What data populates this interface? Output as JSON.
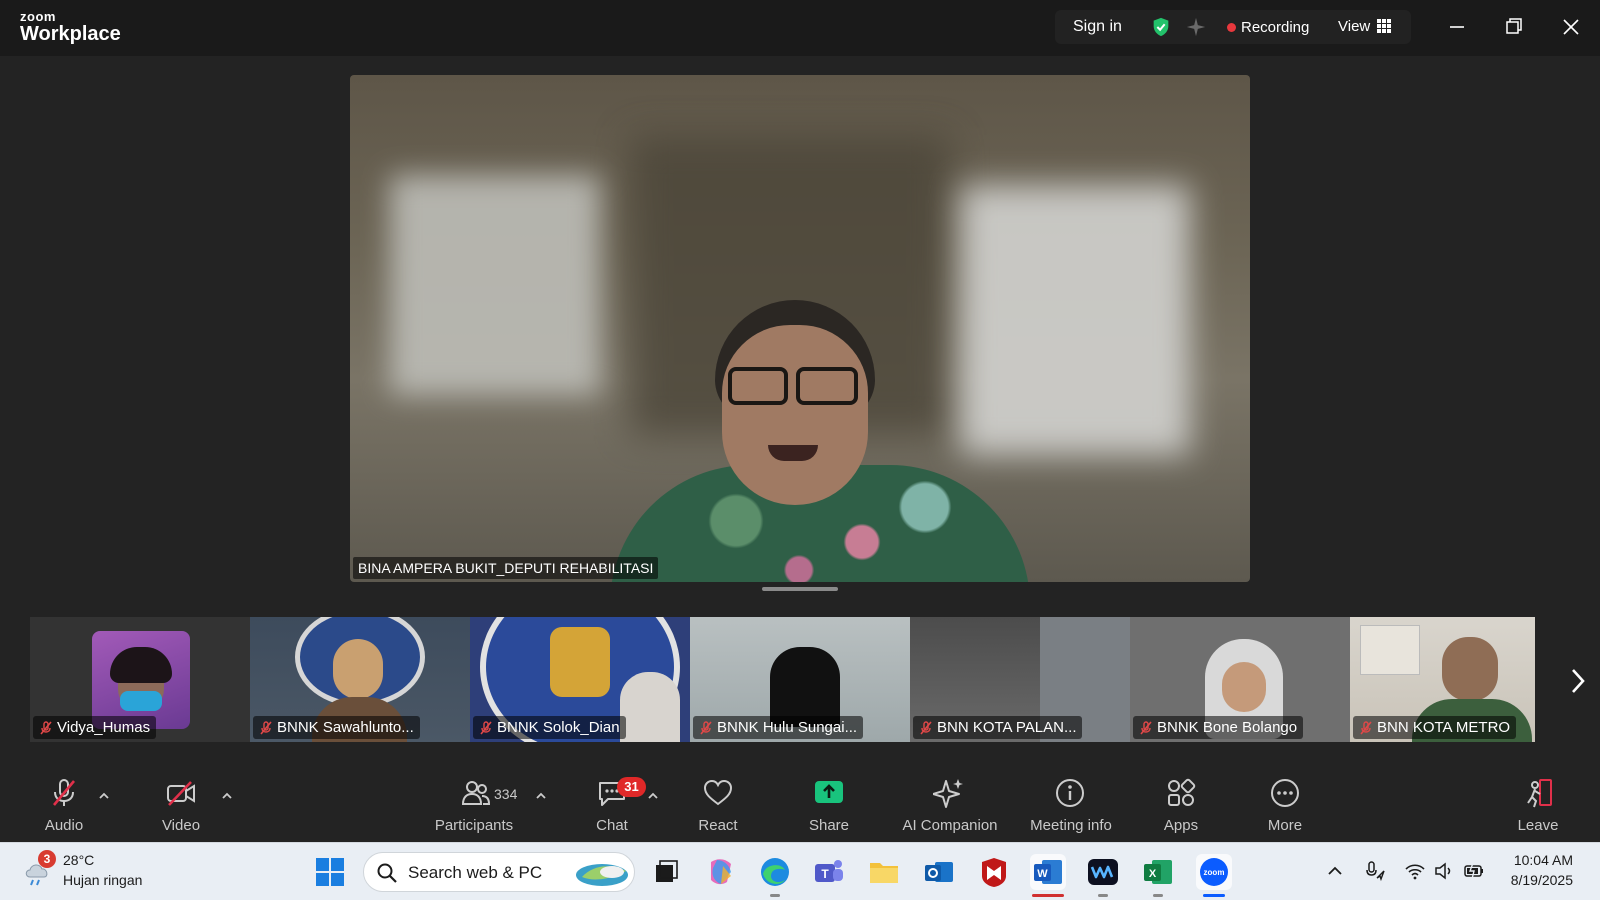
{
  "titlebar": {
    "logo_top": "zoom",
    "logo_bottom": "Workplace",
    "sign_in": "Sign in",
    "recording": "Recording",
    "view": "View"
  },
  "main_video": {
    "participant_name": "BINA AMPERA BUKIT_DEPUTI REHABILITASI"
  },
  "thumbnails": [
    {
      "name": "Vidya_Humas",
      "muted": true
    },
    {
      "name": "BNNK Sawahlunto...",
      "muted": true
    },
    {
      "name": "BNNK Solok_Dian",
      "muted": true
    },
    {
      "name": "BNNK Hulu Sungai...",
      "muted": true
    },
    {
      "name": "BNN KOTA PALAN...",
      "muted": true
    },
    {
      "name": "BNNK Bone Bolango",
      "muted": true
    },
    {
      "name": "BNN KOTA METRO",
      "muted": true
    }
  ],
  "toolbar": {
    "audio": "Audio",
    "video": "Video",
    "participants": "Participants",
    "participants_count": "334",
    "chat": "Chat",
    "chat_badge": "31",
    "react": "React",
    "share": "Share",
    "ai_companion": "AI Companion",
    "meeting_info": "Meeting info",
    "apps": "Apps",
    "more": "More",
    "leave": "Leave"
  },
  "taskbar": {
    "weather_badge": "3",
    "temperature": "28°C",
    "condition": "Hujan ringan",
    "search_placeholder": "Search web & PC",
    "time": "10:04 AM",
    "date": "8/19/2025"
  },
  "colors": {
    "titlebar_bg": "#1a1a1a",
    "app_bg": "#232323",
    "recording_dot": "#e8383d",
    "share_green": "#19c37d",
    "badge_red": "#e02828",
    "taskbar_bg": "#e9eef4"
  }
}
